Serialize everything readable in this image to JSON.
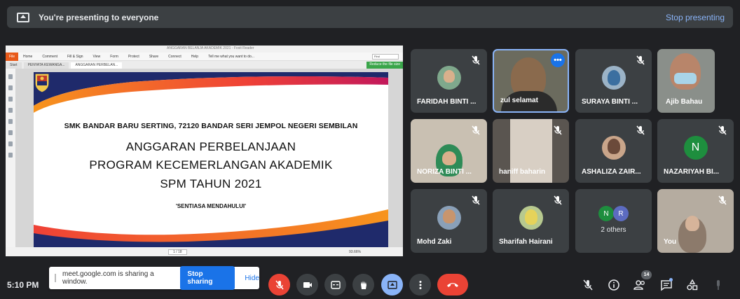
{
  "banner": {
    "message": "You're presenting to everyone",
    "stop_label": "Stop presenting"
  },
  "presentation": {
    "window_title": "ANGGARAN BELANJA AKADEMIK 2021 - Foxit Reader",
    "ribbon": [
      "Home",
      "Comment",
      "Fill & Sign",
      "View",
      "Form",
      "Protect",
      "Share",
      "Connect",
      "Help"
    ],
    "file_label": "File",
    "tell_me": "Tell me what you want to do...",
    "find_placeholder": "Find",
    "tabs": [
      "Start",
      "PENYATA KEWANGA...",
      "ANGGARAN PERBELAN..."
    ],
    "reduce_label": "Reduce the file size",
    "school_line": "SMK BANDAR BARU SERTING, 72120 BANDAR SERI JEMPOL NEGERI SEMBILAN",
    "title_lines": [
      "ANGGARAN PERBELANJAAN",
      "PROGRAM KECEMERLANGAN AKADEMIK",
      "SPM TAHUN 2021"
    ],
    "motto": "'SENTIASA MENDAHULUI'",
    "page_indicator": "1 / 18",
    "zoom": "93.66%"
  },
  "participants": [
    {
      "name": "FARIDAH BINTI ...",
      "muted": true
    },
    {
      "name": "zul selamat",
      "muted": false,
      "speaking": true
    },
    {
      "name": "SURAYA BINTI ...",
      "muted": true
    },
    {
      "name": "Ajib Bahau",
      "muted": false
    },
    {
      "name": "NORIZA BINTI ...",
      "muted": true
    },
    {
      "name": "haniff baharin",
      "muted": true
    },
    {
      "name": "ASHALIZA ZAIR...",
      "muted": true
    },
    {
      "name": "NAZARIYAH BI...",
      "muted": true,
      "initial": "N"
    },
    {
      "name": "Mohd Zaki",
      "muted": true
    },
    {
      "name": "Sharifah Hairani",
      "muted": true
    },
    {
      "others_label": "2 others",
      "initials": [
        "N",
        "R"
      ]
    },
    {
      "name": "You",
      "muted": true
    }
  ],
  "bottom": {
    "time": "5:10 PM",
    "sharing_text": "meet.google.com is sharing a window.",
    "stop_sharing": "Stop sharing",
    "hide": "Hide",
    "participant_count": "14"
  },
  "colors": {
    "background": "#202124",
    "tile": "#3c4043",
    "accent": "#8ab4f8",
    "danger": "#ea4335",
    "primary": "#1a73e8"
  }
}
